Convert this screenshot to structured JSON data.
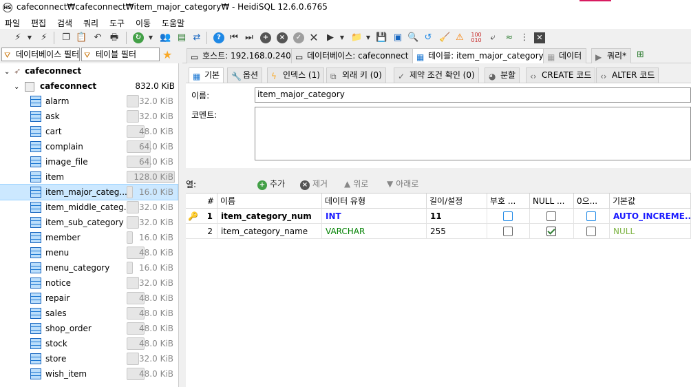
{
  "window": {
    "title": "cafeconnect₩cafeconnect₩item_major_category₩ - HeidiSQL 12.6.0.6765",
    "app_icon": "HS"
  },
  "menu": [
    "파일",
    "편집",
    "검색",
    "쿼리",
    "도구",
    "이동",
    "도움말"
  ],
  "filters": {
    "db_filter": "데이터베이스 필터",
    "table_filter": "테이블 필터"
  },
  "tree": {
    "server": "cafeconnect",
    "database": {
      "name": "cafeconnect",
      "size": "832.0 KiB"
    },
    "tables": [
      {
        "name": "alarm",
        "size": "32.0 KiB",
        "fill": 0.25
      },
      {
        "name": "ask",
        "size": "32.0 KiB",
        "fill": 0.25
      },
      {
        "name": "cart",
        "size": "48.0 KiB",
        "fill": 0.375
      },
      {
        "name": "complain",
        "size": "64.0 KiB",
        "fill": 0.5
      },
      {
        "name": "image_file",
        "size": "64.0 KiB",
        "fill": 0.5
      },
      {
        "name": "item",
        "size": "128.0 KiB",
        "fill": 1.0
      },
      {
        "name": "item_major_categ...",
        "size": "16.0 KiB",
        "fill": 0.125
      },
      {
        "name": "item_middle_categ...",
        "size": "32.0 KiB",
        "fill": 0.25
      },
      {
        "name": "item_sub_category",
        "size": "32.0 KiB",
        "fill": 0.25
      },
      {
        "name": "member",
        "size": "16.0 KiB",
        "fill": 0.125
      },
      {
        "name": "menu",
        "size": "48.0 KiB",
        "fill": 0.375
      },
      {
        "name": "menu_category",
        "size": "16.0 KiB",
        "fill": 0.125
      },
      {
        "name": "notice",
        "size": "32.0 KiB",
        "fill": 0.25
      },
      {
        "name": "repair",
        "size": "48.0 KiB",
        "fill": 0.375
      },
      {
        "name": "sales",
        "size": "48.0 KiB",
        "fill": 0.375
      },
      {
        "name": "shop_order",
        "size": "48.0 KiB",
        "fill": 0.375
      },
      {
        "name": "stock",
        "size": "48.0 KiB",
        "fill": 0.375
      },
      {
        "name": "store",
        "size": "32.0 KiB",
        "fill": 0.25
      },
      {
        "name": "wish_item",
        "size": "48.0 KiB",
        "fill": 0.375
      }
    ],
    "selected_index": 6
  },
  "main_tabs": [
    {
      "label": "호스트: 192.168.0.240",
      "icon": "host-icon"
    },
    {
      "label": "데이터베이스: cafeconnect",
      "icon": "database-icon"
    },
    {
      "label": "테이블: item_major_category",
      "icon": "table-icon"
    },
    {
      "label": "데이터",
      "icon": "data-icon"
    },
    {
      "label": "쿼리*",
      "icon": "play-icon"
    }
  ],
  "editor_tabs": [
    "기본",
    "옵션",
    "인덱스 (1)",
    "외래 키 (0)",
    "제약 조건 확인 (0)",
    "분할",
    "CREATE 코드",
    "ALTER 코드"
  ],
  "basic": {
    "name_label": "이름:",
    "name_value": "item_major_category",
    "comment_label": "코멘트:"
  },
  "columns_bar": {
    "label": "열:",
    "add": "추가",
    "remove": "제거",
    "up": "위로",
    "down": "아래로"
  },
  "grid": {
    "headers": [
      "#",
      "이름",
      "데이터 유형",
      "길이/설정",
      "부호 ...",
      "NULL ...",
      "0으...",
      "기본값"
    ],
    "rows": [
      {
        "num": "1",
        "name": "item_category_num",
        "type": "INT",
        "length": "11",
        "unsigned": false,
        "allow_null": false,
        "zerofill": false,
        "default": "AUTO_INCREME...",
        "primary_key": true
      },
      {
        "num": "2",
        "name": "item_category_name",
        "type": "VARCHAR",
        "length": "255",
        "unsigned": false,
        "allow_null": true,
        "zerofill": false,
        "default": "NULL",
        "primary_key": false
      }
    ]
  },
  "colors": {
    "int_type": "#1a1aff",
    "varchar_type": "#008000",
    "null_default": "#7cb342",
    "selection": "#cce8ff",
    "accent": "#1976d2"
  }
}
